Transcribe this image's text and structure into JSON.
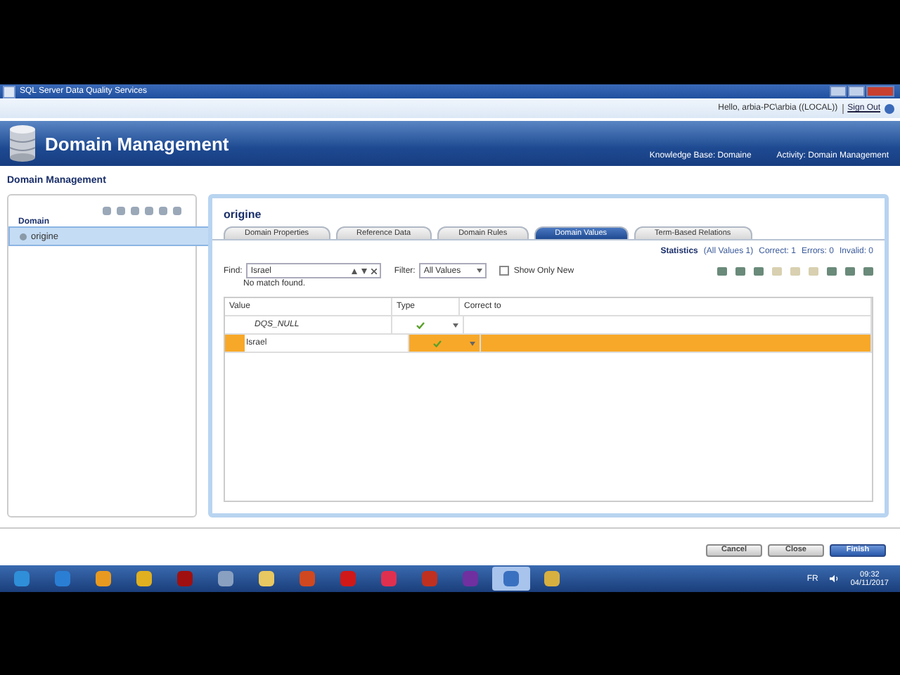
{
  "window": {
    "title": "SQL Server Data Quality Services"
  },
  "user_bar": {
    "greeting": "Hello, arbia-PC\\arbia ((LOCAL))",
    "sign_out": "Sign Out"
  },
  "header": {
    "title": "Domain Management",
    "knowledge_base": "Knowledge Base: Domaine",
    "activity": "Activity: Domain Management"
  },
  "page_title": "Domain Management",
  "sidebar": {
    "heading": "Domain",
    "items": [
      {
        "label": "origine",
        "selected": true
      }
    ]
  },
  "panel": {
    "title": "origine",
    "tabs": [
      {
        "label": "Domain Properties",
        "selected": false
      },
      {
        "label": "Reference Data",
        "selected": false
      },
      {
        "label": "Domain Rules",
        "selected": false
      },
      {
        "label": "Domain Values",
        "selected": true
      },
      {
        "label": "Term-Based Relations",
        "selected": false
      }
    ],
    "statistics": {
      "label": "Statistics",
      "all": "(All Values 1)",
      "correct": "Correct: 1",
      "errors": "Errors: 0",
      "invalid": "Invalid: 0"
    },
    "find": {
      "label": "Find:",
      "value": "Israel",
      "message": "No match found."
    },
    "filter": {
      "label": "Filter:",
      "value": "All Values"
    },
    "show_only_new": {
      "label": "Show Only New",
      "checked": false
    },
    "table": {
      "columns": [
        "Value",
        "Type",
        "Correct to"
      ],
      "rows": [
        {
          "value": "DQS_NULL",
          "kind": "null",
          "selected": false
        },
        {
          "value": "Israel",
          "kind": "value",
          "selected": true
        }
      ]
    }
  },
  "buttons": [
    {
      "label": "Cancel",
      "kind": "normal"
    },
    {
      "label": "Close",
      "kind": "normal"
    },
    {
      "label": "Finish",
      "kind": "primary"
    }
  ],
  "taskbar": {
    "language": "FR",
    "time": "09:32",
    "date": "04/11/2017"
  }
}
